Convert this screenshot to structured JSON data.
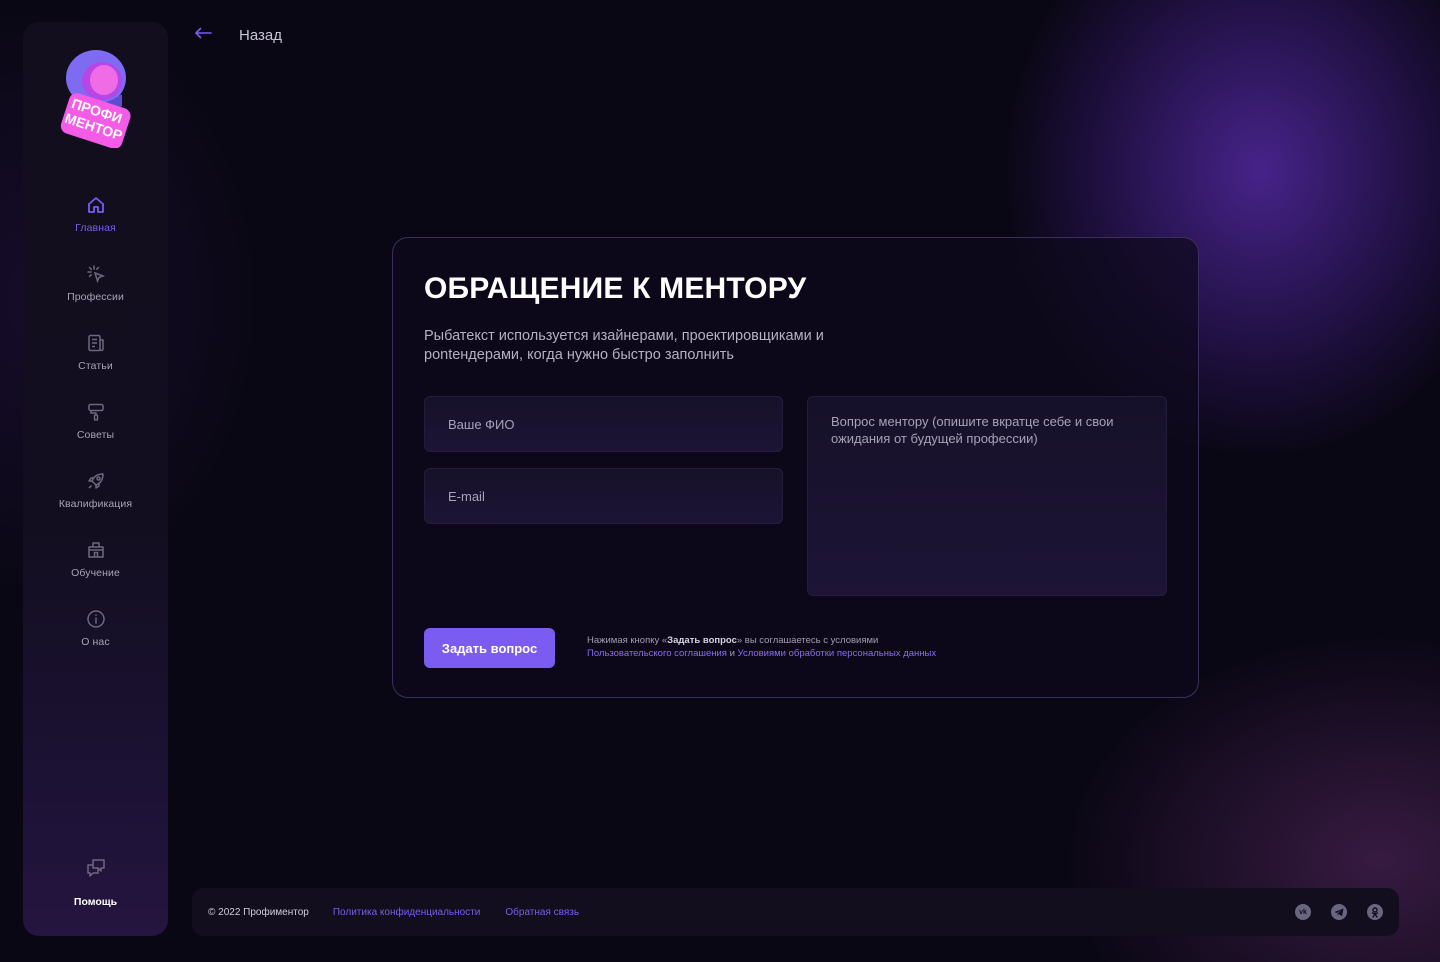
{
  "app": {
    "logo_text_line1": "ПРОФИ",
    "logo_text_line2": "МЕНТОР",
    "accent_color": "#7b5cf0"
  },
  "sidebar": {
    "items": [
      {
        "label": "Главная",
        "icon": "home-icon",
        "active": true
      },
      {
        "label": "Профессии",
        "icon": "cursor-click-icon",
        "active": false
      },
      {
        "label": "Статьи",
        "icon": "article-icon",
        "active": false
      },
      {
        "label": "Советы",
        "icon": "brush-icon",
        "active": false
      },
      {
        "label": "Квалификация",
        "icon": "rocket-icon",
        "active": false
      },
      {
        "label": "Обучение",
        "icon": "school-icon",
        "active": false
      },
      {
        "label": "О нас",
        "icon": "info-icon",
        "active": false
      }
    ],
    "help_label": "Помощь",
    "help_icon": "chat-icon"
  },
  "header": {
    "back_label": "Назад",
    "back_icon": "arrow-left-icon"
  },
  "form": {
    "title": "ОБРАЩЕНИЕ К МЕНТОРУ",
    "description": "Рыбатекст используется изайнерами, проектировщиками и рontендерами, когда нужно быстро заполнить",
    "name_placeholder": "Ваше ФИО",
    "email_placeholder": "E-mail",
    "question_placeholder": "Вопрос ментору (опишите вкратце себе и свои ожидания от будущей профессии)",
    "submit_label": "Задать вопрос",
    "terms_prefix": "Нажимая кнопку «",
    "terms_bold": "Задать вопрос",
    "terms_middle": "» вы соглашаетесь с условиями",
    "terms_link1": "Пользовательского соглашения",
    "terms_and": " и ",
    "terms_link2": "Условиями обработки персональных данных"
  },
  "footer": {
    "copyright": "© 2022 Профиментор",
    "privacy_link": "Политика конфиденциальности",
    "feedback_link": "Обратная связь",
    "socials": [
      "vk-icon",
      "telegram-icon",
      "odnoklassniki-icon"
    ]
  }
}
